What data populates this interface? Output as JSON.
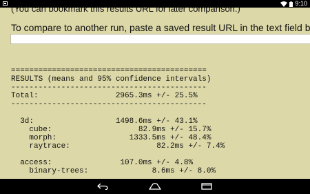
{
  "status_bar": {
    "time": "9:10"
  },
  "page": {
    "bookmark_note": "(You can bookmark this results URL for later comparison.)",
    "compare_instruction": "To compare to another run, paste a saved result URL in the text field below a",
    "url_field_value": ""
  },
  "results": {
    "separator_double": "===========================================",
    "heading": "RESULTS (means and 95% confidence intervals)",
    "separator_single": "-------------------------------------------",
    "total": {
      "label": "Total:",
      "value": "2965.3ms +/- 25.5%"
    },
    "groups": [
      {
        "name": "3d:",
        "value": "1498.6ms +/- 43.1%",
        "tests": [
          {
            "name": "cube:",
            "value": "82.9ms +/- 15.7%"
          },
          {
            "name": "morph:",
            "value": "1333.5ms +/- 48.4%"
          },
          {
            "name": "raytrace:",
            "value": "82.2ms +/- 7.4%"
          }
        ]
      },
      {
        "name": "access:",
        "value": "107.0ms +/- 4.8%",
        "tests": [
          {
            "name": "binary-trees:",
            "value": "8.6ms +/- 8.0%"
          }
        ]
      }
    ]
  },
  "nav_bar": {
    "back_icon": "back-arrow-icon",
    "home_icon": "home-icon",
    "recents_icon": "recents-icon"
  }
}
